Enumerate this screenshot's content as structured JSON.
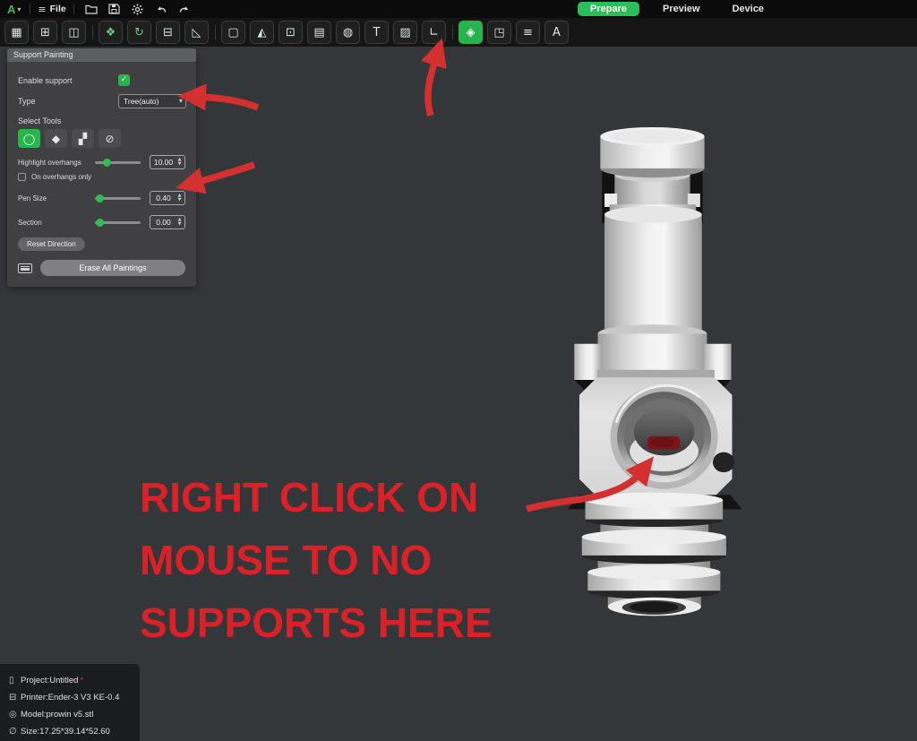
{
  "menubar": {
    "logo_letter": "A",
    "file_label": "File",
    "icons": [
      {
        "name": "open-folder-icon"
      },
      {
        "name": "save-icon"
      },
      {
        "name": "settings-gear-icon"
      },
      {
        "name": "undo-icon"
      },
      {
        "name": "redo-icon"
      }
    ]
  },
  "mode_tabs": [
    {
      "label": "Prepare",
      "active": true
    },
    {
      "label": "Preview",
      "active": false
    },
    {
      "label": "Device",
      "active": false
    }
  ],
  "toolbar": {
    "icons": [
      {
        "name": "plate-settings-icon",
        "glyph": "▦"
      },
      {
        "name": "add-model-icon",
        "glyph": "⊞"
      },
      {
        "name": "add-plate-icon",
        "glyph": "◫"
      },
      {
        "name": "move-icon",
        "glyph": "❖"
      },
      {
        "name": "rotate-icon",
        "glyph": "↻"
      },
      {
        "name": "scale-icon",
        "glyph": "⊟"
      },
      {
        "name": "lay-on-face-icon",
        "glyph": "◺"
      },
      {
        "name": "auto-arrange-icon",
        "glyph": "▢"
      },
      {
        "name": "mirror-icon",
        "glyph": "◭"
      },
      {
        "name": "clone-icon",
        "glyph": "⊡"
      },
      {
        "name": "split-icon",
        "glyph": "▤"
      },
      {
        "name": "cut-icon",
        "glyph": "◍"
      },
      {
        "name": "text-tool-icon",
        "glyph": "T"
      },
      {
        "name": "pattern-paint-icon",
        "glyph": "▨"
      },
      {
        "name": "measure-icon",
        "glyph": "∟"
      },
      {
        "name": "support-paint-icon",
        "glyph": "◈",
        "active": true
      },
      {
        "name": "seam-paint-icon",
        "glyph": "◳"
      },
      {
        "name": "layers-icon",
        "glyph": "≡"
      },
      {
        "name": "text-frame-icon",
        "glyph": "A"
      }
    ]
  },
  "panel": {
    "title": "Support Painting",
    "enable_support_label": "Enable support",
    "enable_support_checked": true,
    "check_glyph": "✓",
    "type_label": "Type",
    "type_value": "Tree(auto)",
    "select_tools_label": "Select Tools",
    "tools": [
      {
        "name": "sphere-brush-tool",
        "glyph": "◯",
        "active": true
      },
      {
        "name": "fill-bucket-tool",
        "glyph": "◆"
      },
      {
        "name": "gap-fill-tool",
        "glyph": "▞"
      },
      {
        "name": "eraser-tool",
        "glyph": "⊘"
      }
    ],
    "highlight_overhangs_label": "Highlight overhangs",
    "highlight_overhangs_value": "10.00",
    "on_overhangs_only_label": "On overhangs only",
    "on_overhangs_only_checked": false,
    "pen_size_label": "Pen Size",
    "pen_size_value": "0.40",
    "section_label": "Section",
    "section_value": "0.00",
    "reset_direction_label": "Reset Direction",
    "erase_all_label": "Erase All Paintings"
  },
  "annotation": {
    "line1": "RIGHT CLICK ON",
    "line2": "MOUSE TO NO",
    "line3": "SUPPORTS HERE"
  },
  "info_box": {
    "rows": [
      {
        "icon": "document-icon",
        "text": "Project:Untitled",
        "suffix": "*"
      },
      {
        "icon": "printer-icon",
        "text": "Printer:Ender-3 V3 KE-0.4"
      },
      {
        "icon": "model-icon",
        "text": "Model:prowin v5.stl"
      },
      {
        "icon": "size-icon",
        "text": "Size:17.25*39.14*52.60"
      }
    ]
  },
  "colors": {
    "accent_green": "#28c157",
    "active_tool_green": "#25b44e",
    "annotation_red": "#da2127",
    "arrow_red": "#d53030",
    "canvas_bg": "#34373a",
    "panel_bg": "#414143",
    "paint_blocker_red": "#7c1418"
  }
}
